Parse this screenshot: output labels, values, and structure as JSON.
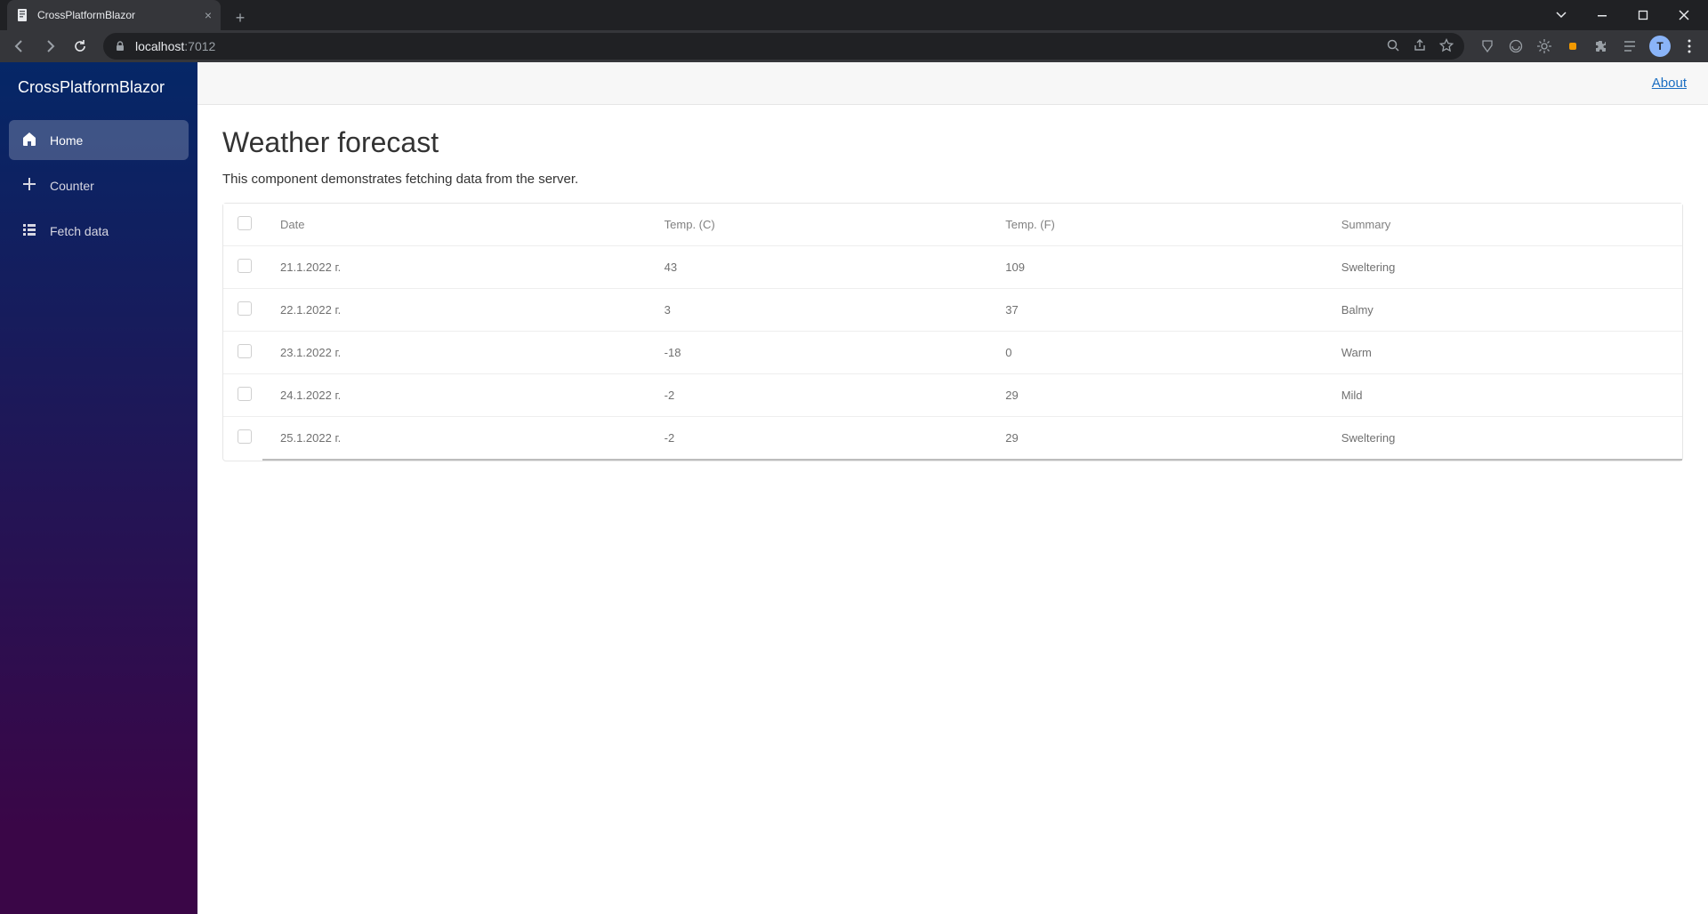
{
  "browser": {
    "tabTitle": "CrossPlatformBlazor",
    "urlHost": "localhost",
    "urlPort": ":7012",
    "avatarInitial": "T"
  },
  "sidebar": {
    "brand": "CrossPlatformBlazor",
    "items": [
      {
        "label": "Home",
        "icon": "home-icon",
        "active": true
      },
      {
        "label": "Counter",
        "icon": "plus-icon",
        "active": false
      },
      {
        "label": "Fetch data",
        "icon": "list-icon",
        "active": false
      }
    ]
  },
  "topbar": {
    "aboutLabel": "About"
  },
  "page": {
    "title": "Weather forecast",
    "description": "This component demonstrates fetching data from the server."
  },
  "table": {
    "headers": {
      "date": "Date",
      "tempC": "Temp. (C)",
      "tempF": "Temp. (F)",
      "summary": "Summary"
    },
    "rows": [
      {
        "date": "21.1.2022 г.",
        "tempC": "43",
        "tempF": "109",
        "summary": "Sweltering"
      },
      {
        "date": "22.1.2022 г.",
        "tempC": "3",
        "tempF": "37",
        "summary": "Balmy"
      },
      {
        "date": "23.1.2022 г.",
        "tempC": "-18",
        "tempF": "0",
        "summary": "Warm"
      },
      {
        "date": "24.1.2022 г.",
        "tempC": "-2",
        "tempF": "29",
        "summary": "Mild"
      },
      {
        "date": "25.1.2022 г.",
        "tempC": "-2",
        "tempF": "29",
        "summary": "Sweltering"
      }
    ]
  }
}
